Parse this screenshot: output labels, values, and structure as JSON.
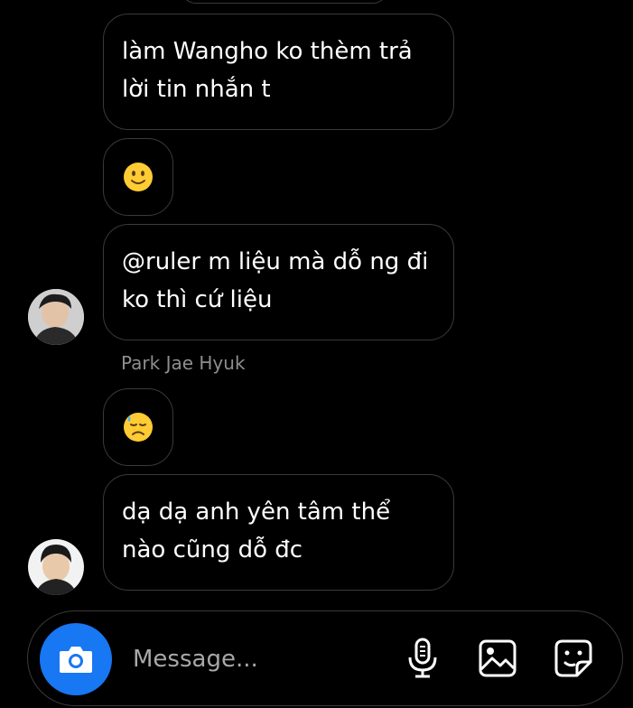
{
  "messages": [
    {
      "id": "m1",
      "text": "làm Wangho ko thèm trả lời tin nhắn t"
    },
    {
      "id": "m2",
      "emoji": "🙂",
      "emoji_name": "slightly-smiling-face"
    },
    {
      "id": "m3",
      "text": "@ruler m liệu mà dỗ ng đi ko thì cứ liệu"
    },
    {
      "id": "m4",
      "sender": "Park Jae Hyuk",
      "emoji": "😓",
      "emoji_name": "downcast-face-with-sweat"
    },
    {
      "id": "m5",
      "text": "dạ dạ anh yên tâm thể nào cũng dỗ đc"
    }
  ],
  "composer": {
    "placeholder": "Message...",
    "icons": [
      "camera-icon",
      "microphone-icon",
      "gallery-icon",
      "sticker-icon"
    ]
  },
  "colors": {
    "background": "#000000",
    "bubble_border": "#3a3a3a",
    "camera_button": "#1877f2",
    "sender_text": "#8e8e8e"
  }
}
